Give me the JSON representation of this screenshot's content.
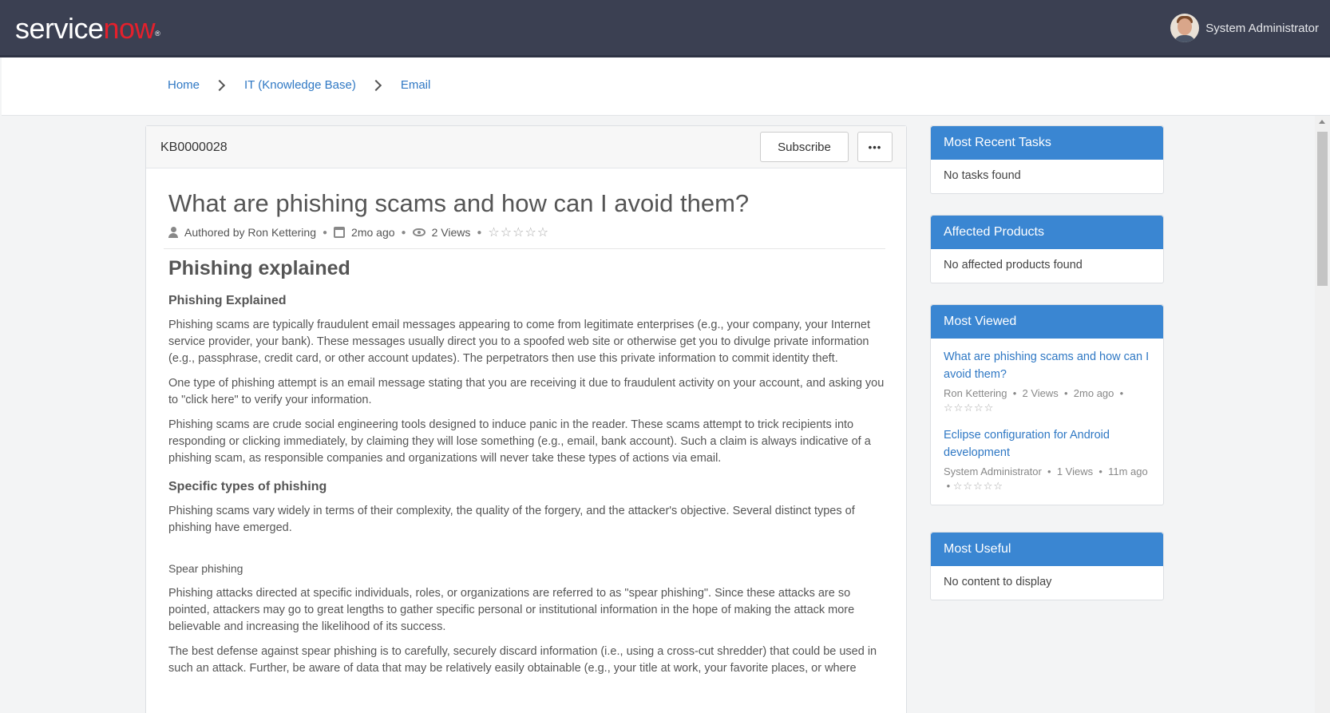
{
  "header": {
    "logo_service": "service",
    "logo_now": "now",
    "user_name": "System Administrator"
  },
  "breadcrumb": {
    "items": [
      "Home",
      "IT (Knowledge Base)",
      "Email"
    ]
  },
  "article": {
    "number": "KB0000028",
    "subscribe_label": "Subscribe",
    "more_label": "•••",
    "title": "What are phishing scams and how can I avoid them?",
    "author": "Authored by Ron Kettering",
    "age": "2mo ago",
    "views": "2 Views",
    "rating_stars": "☆☆☆☆☆",
    "h1": "Phishing explained",
    "h3_1": "Phishing Explained",
    "p1": "Phishing scams are typically fraudulent email messages appearing to come from legitimate enterprises (e.g., your company, your Internet service provider, your bank). These messages usually direct you to a spoofed web site or otherwise get you to divulge private information (e.g., passphrase, credit card, or other account updates). The perpetrators then use this private information to commit identity theft.",
    "p2": "One type of phishing attempt is an email message stating that you are receiving it due to fraudulent activity on your account, and asking you to \"click here\" to verify your information.",
    "p3": "Phishing scams are crude social engineering tools designed to induce panic in the reader. These scams attempt to trick recipients into responding or clicking immediately, by claiming they will lose something (e.g., email, bank account). Such a claim is always indicative of a phishing scam, as responsible companies and organizations will never take these types of actions via email.",
    "h3_2": "Specific types of phishing",
    "p4": "Phishing scams vary widely in terms of their complexity, the quality of the forgery, and the attacker's objective. Several distinct types of phishing have emerged.",
    "h6": "Spear phishing",
    "p5": "Phishing attacks directed at specific individuals, roles, or organizations are referred to as \"spear phishing\". Since these attacks are so pointed, attackers may go to great lengths to gather specific personal or institutional information in the hope of making the attack more believable and increasing the likelihood of its success.",
    "p6": "The best defense against spear phishing is to carefully, securely discard information (i.e., using a cross-cut shredder) that could be used in such an attack. Further, be aware of data that may be relatively easily obtainable (e.g., your title at work, your favorite places, or where"
  },
  "sidebar": {
    "recent_tasks": {
      "title": "Most Recent Tasks",
      "empty": "No tasks found"
    },
    "affected_products": {
      "title": "Affected Products",
      "empty": "No affected products found"
    },
    "most_viewed": {
      "title": "Most Viewed",
      "items": [
        {
          "title": "What are phishing scams and how can I avoid them?",
          "author": "Ron Kettering",
          "views": "2 Views",
          "age": "2mo ago",
          "stars": "☆☆☆☆☆"
        },
        {
          "title": "Eclipse configuration for Android development",
          "author": "System Administrator",
          "views": "1 Views",
          "age": "11m ago",
          "stars": "☆☆☆☆☆"
        }
      ]
    },
    "most_useful": {
      "title": "Most Useful",
      "empty": "No content to display"
    }
  },
  "colors": {
    "topbar": "#3b4052",
    "brand_red": "#e4202c",
    "link": "#2f78c4",
    "panel_header": "#3a86d2"
  },
  "icons": [
    "user-icon",
    "calendar-icon",
    "eye-icon",
    "chevron-right-icon"
  ]
}
